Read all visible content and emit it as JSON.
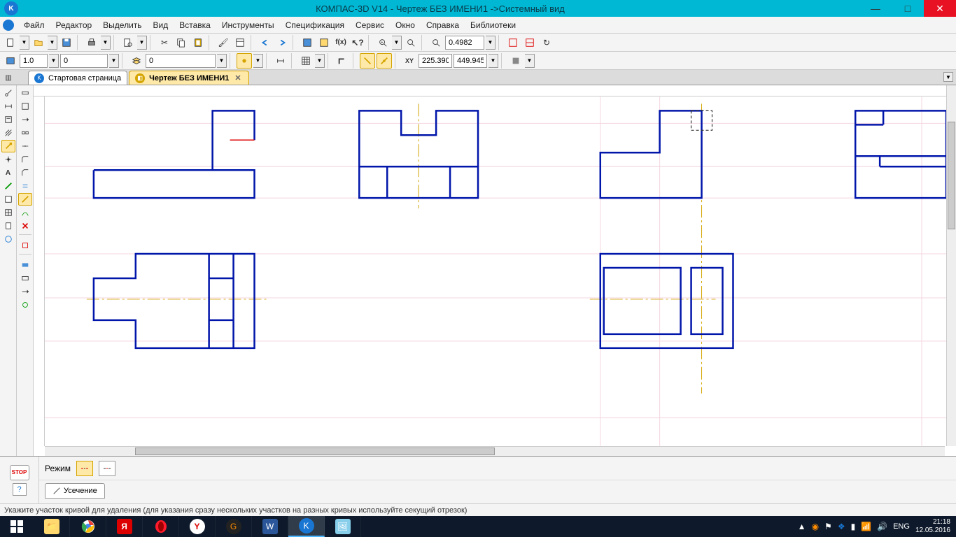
{
  "title": "КОМПАС-3D V14 - Чертеж БЕЗ ИМЕНИ1 ->Системный вид",
  "menu": [
    "Файл",
    "Редактор",
    "Выделить",
    "Вид",
    "Вставка",
    "Инструменты",
    "Спецификация",
    "Сервис",
    "Окно",
    "Справка",
    "Библиотеки"
  ],
  "toolbar2": {
    "scale": "1.0",
    "layer": "0",
    "style": "0",
    "zoom": "0.4982",
    "coord_x": "225.390",
    "coord_y": "449.945"
  },
  "tabs": {
    "start": "Стартовая страница",
    "doc": "Чертеж БЕЗ ИМЕНИ1"
  },
  "prop": {
    "mode_label": "Режим",
    "tab_label": "Усечение"
  },
  "status": "Укажите участок кривой для удаления (для указания сразу нескольких участков на разных кривых используйте секущий отрезок)",
  "tray": {
    "lang": "ENG",
    "time": "21:18",
    "date": "12.05.2016"
  }
}
